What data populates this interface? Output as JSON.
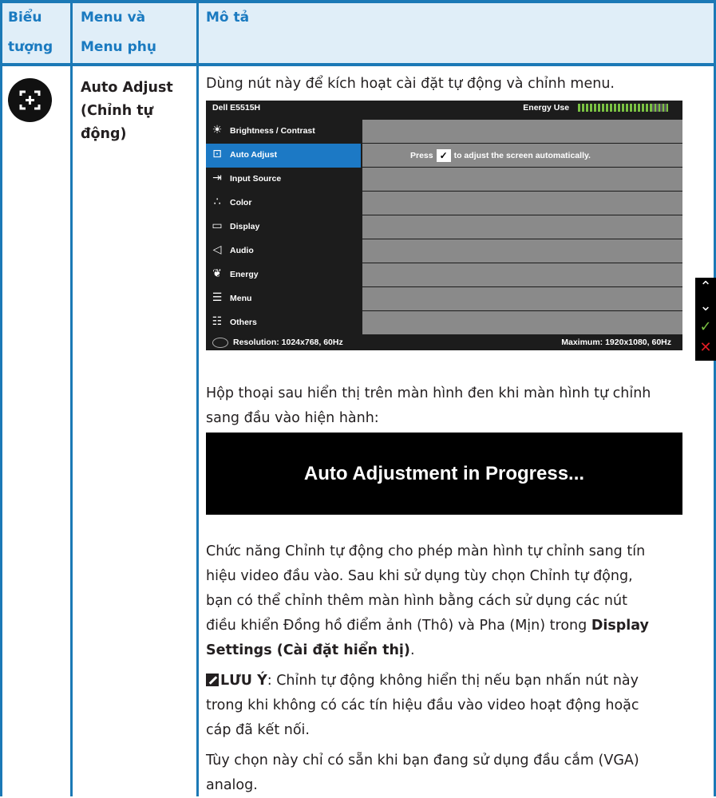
{
  "header": {
    "col1": "Biểu tượng",
    "col2": "Menu và Menu phụ",
    "col3": "Mô tả"
  },
  "row": {
    "icon": "auto-adjust-icon",
    "menu_line1": "Auto Adjust",
    "menu_line2": "(Chỉnh tự",
    "menu_line3": "động)",
    "intro": "Dùng nút này để kích hoạt cài đặt tự động và chỉnh menu.",
    "osd": {
      "model": "Dell E5515H",
      "energy_label": "Energy Use",
      "energy_level": 0.82,
      "items": [
        {
          "label": "Brightness / Contrast",
          "icon": "sun-icon"
        },
        {
          "label": "Auto Adjust",
          "icon": "auto-adjust-icon",
          "active": true
        },
        {
          "label": "Input Source",
          "icon": "input-icon"
        },
        {
          "label": "Color",
          "icon": "color-dots-icon"
        },
        {
          "label": "Display",
          "icon": "display-icon"
        },
        {
          "label": "Audio",
          "icon": "speaker-icon"
        },
        {
          "label": "Energy",
          "icon": "leaf-icon"
        },
        {
          "label": "Menu",
          "icon": "menu-icon"
        },
        {
          "label": "Others",
          "icon": "sliders-icon"
        }
      ],
      "panel_press": "Press",
      "panel_rest": "to adjust the screen automatically.",
      "resolution": "Resolution: 1024x768, 60Hz",
      "maximum": "Maximum: 1920x1080, 60Hz"
    },
    "dialog_text_1": "Hộp thoại sau hiển thị trên màn hình đen khi màn hình tự chỉnh",
    "dialog_text_2": "sang đầu vào hiện hành:",
    "progress": "Auto Adjustment in Progress...",
    "para1_a": "Chức năng Chỉnh tự động cho phép màn hình tự chỉnh sang tín",
    "para1_b": "hiệu video đầu vào. Sau khi sử dụng tùy chọn Chỉnh tự động,",
    "para1_c": "bạn có thể chỉnh thêm màn hình bằng cách sử dụng các nút",
    "para1_d": "điều khiển Đồng hồ điểm ảnh (Thô) và Pha (Mịn) trong",
    "para1_bold1": "Display",
    "para1_bold2": "Settings (Cài đặt hiển thị)",
    "para1_end": ".",
    "note_label": "LƯU Ý",
    "note_a": ": Chỉnh tự động không hiển thị nếu bạn nhấn nút này",
    "note_b": "trong khi không có các tín hiệu đầu vào video hoạt động hoặc",
    "note_c": "cáp đã kết nối.",
    "para2_a": "Tùy chọn này chỉ có sẵn khi bạn đang sử dụng đầu cắm (VGA)",
    "para2_b": "analog."
  },
  "colors": {
    "accent": "#1b79b6",
    "header_bg": "#e0eef8",
    "osd_active": "#1c79c5",
    "energy_green": "#7ac143"
  }
}
